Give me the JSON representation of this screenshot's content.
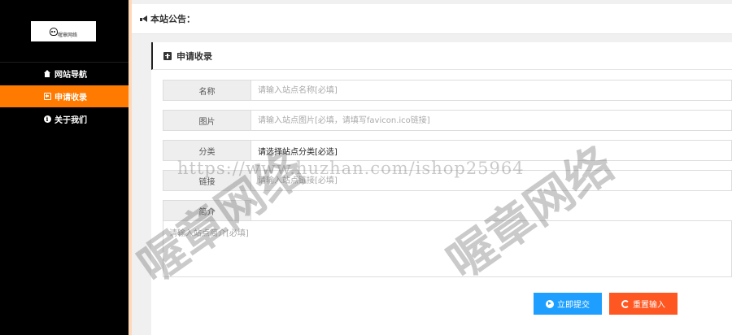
{
  "sidebar": {
    "logo_text": "喔章网络",
    "items": [
      {
        "label": "网站导航",
        "icon": "home-icon",
        "active": false
      },
      {
        "label": "申请收录",
        "icon": "plus-square-icon",
        "active": true
      },
      {
        "label": "关于我们",
        "icon": "info-icon",
        "active": false
      }
    ]
  },
  "notice": {
    "label": "本站公告："
  },
  "panel": {
    "title": "申请收录",
    "form": {
      "name": {
        "label": "名称",
        "placeholder": "请输入站点名称[必填]"
      },
      "image": {
        "label": "图片",
        "placeholder": "请输入站点图片[必填，请填写favicon.ico链接]"
      },
      "category": {
        "label": "分类",
        "value": "请选择站点分类[必选]"
      },
      "link": {
        "label": "链接",
        "placeholder": "请输入站点链接[必填]"
      },
      "intro": {
        "label": "简介",
        "placeholder": "请输入站点简介[必填]"
      }
    },
    "submit_label": "立即提交",
    "reset_label": "重置输入"
  },
  "watermark": {
    "url": "https://www.huzhan.com/ishop25964",
    "text1": "喔章网络",
    "text2": "喔章网络"
  },
  "colors": {
    "sidebar_bg": "#000000",
    "active_item": "#ff7a00",
    "submit_button": "#1e9fff",
    "reset_button": "#ff5722"
  }
}
